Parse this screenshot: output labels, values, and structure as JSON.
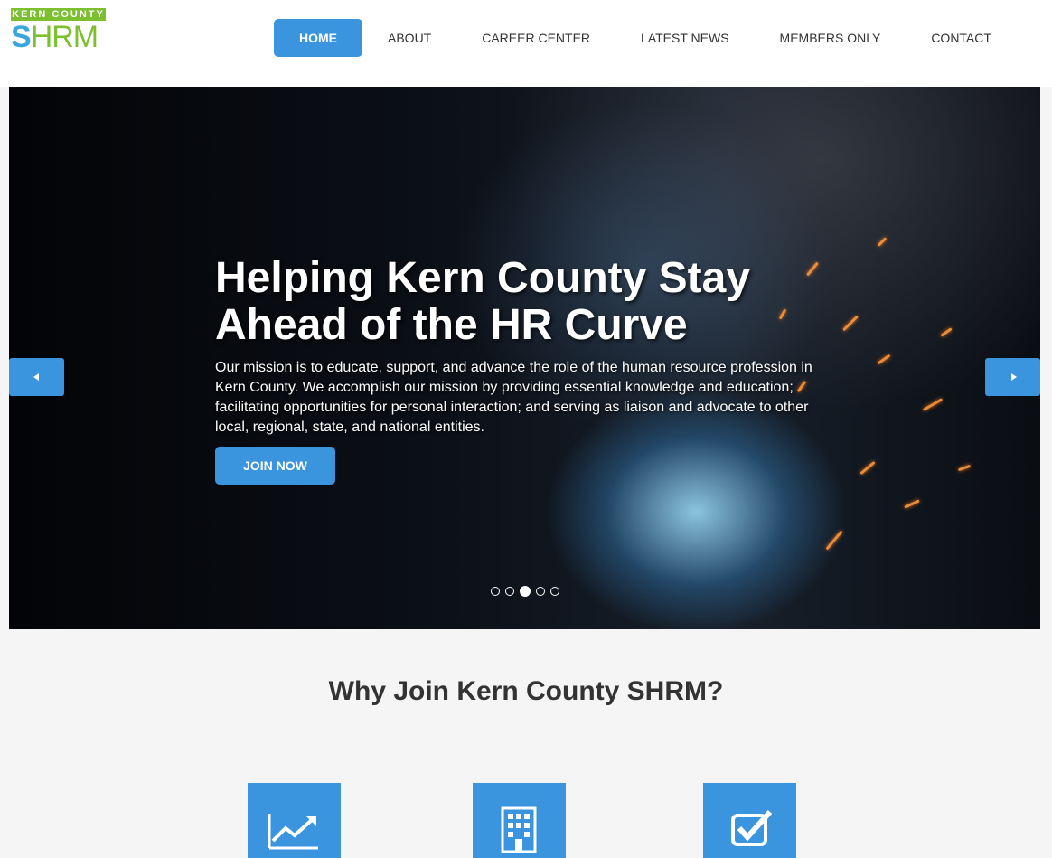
{
  "logo": {
    "top_text": "KERN COUNTY",
    "bottom_s": "S",
    "bottom_rest": "HRM"
  },
  "nav": {
    "items": [
      {
        "label": "HOME",
        "active": true
      },
      {
        "label": "ABOUT"
      },
      {
        "label": "CAREER CENTER"
      },
      {
        "label": "LATEST NEWS"
      },
      {
        "label": "MEMBERS ONLY"
      },
      {
        "label": "CONTACT"
      }
    ]
  },
  "hero": {
    "title": "Helping Kern County Stay Ahead of the HR Curve",
    "text": "Our mission is to educate, support, and advance the role of the human resource profession in Kern County. We accomplish our mission by providing essential knowledge and education; facilitating opportunities for personal interaction; and serving as liaison and advocate to other local, regional, state, and national entities.",
    "button": "JOIN NOW",
    "slide_count": 5,
    "active_slide": 3
  },
  "why": {
    "title": "Why Join Kern County SHRM?",
    "icons": [
      "trending-up-icon",
      "building-icon",
      "checkbox-icon"
    ]
  },
  "colors": {
    "accent": "#3a95de",
    "logo_green": "#7cbf2f",
    "logo_blue": "#3aa6dd"
  }
}
